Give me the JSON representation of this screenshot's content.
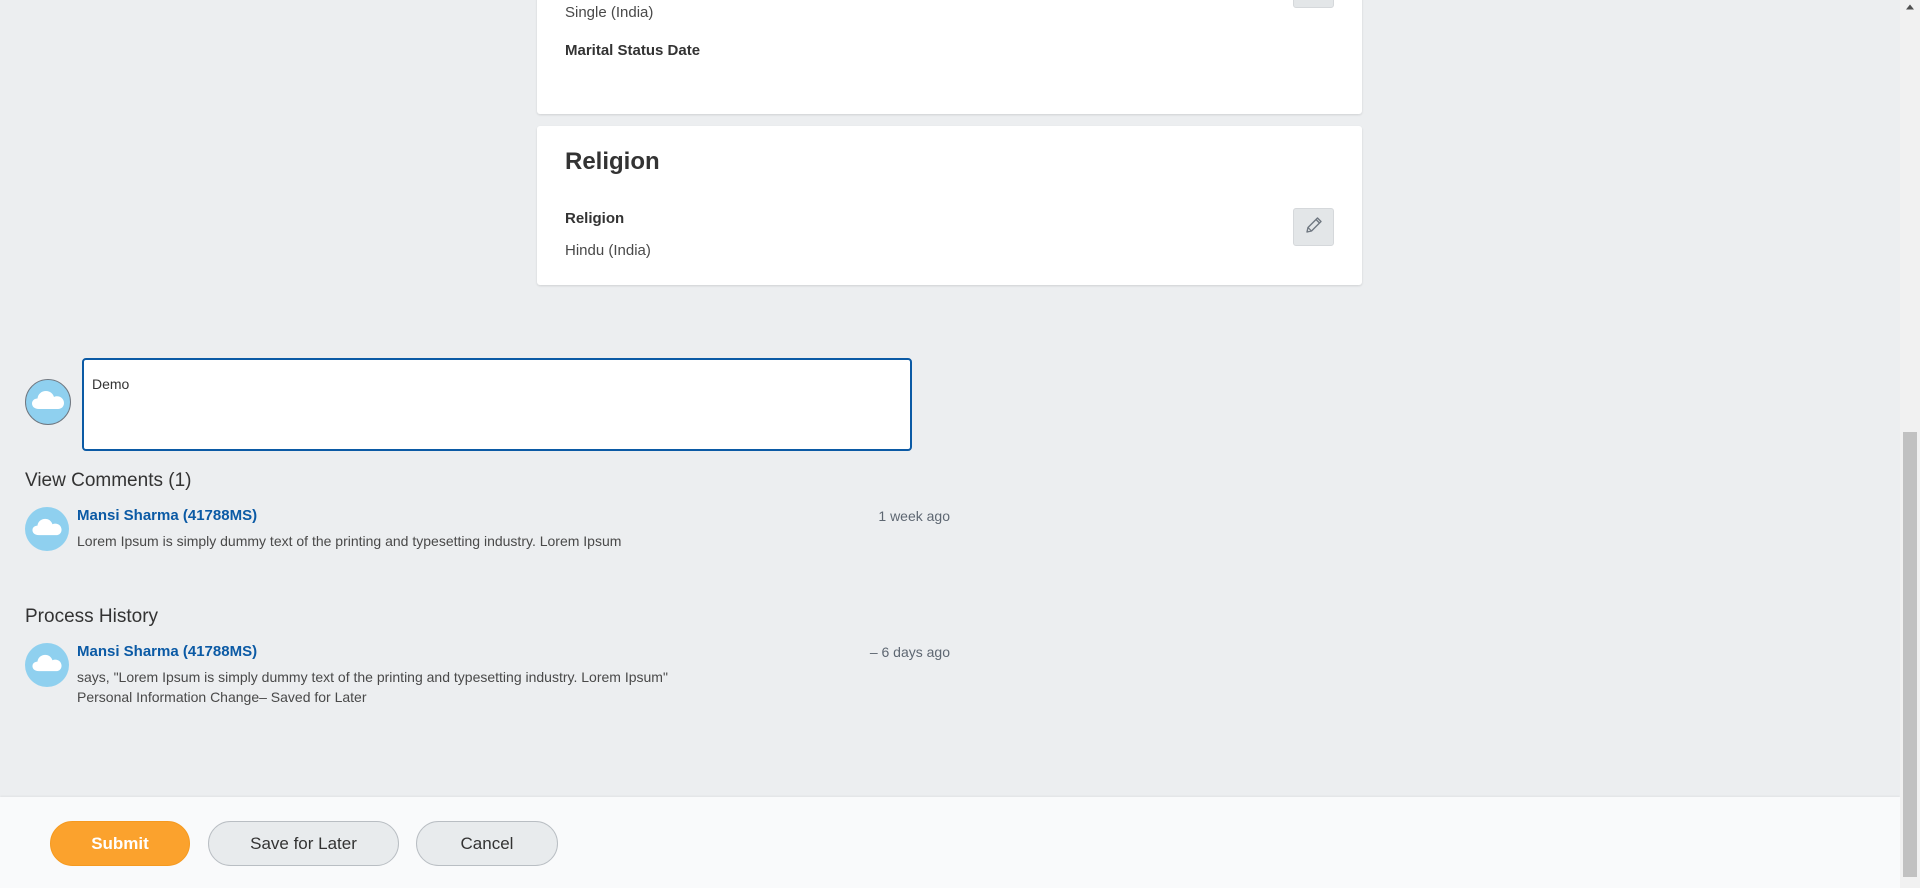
{
  "marital_card": {
    "status_value": "Single (India)",
    "status_date_label": "Marital Status Date"
  },
  "religion_card": {
    "title": "Religion",
    "field_label": "Religion",
    "field_value": "Hindu (India)"
  },
  "comment_box": {
    "value": "Demo"
  },
  "view_comments": {
    "heading": "View Comments (1)",
    "items": [
      {
        "author": "Mansi Sharma (41788MS)",
        "time": "1 week ago",
        "text": "Lorem Ipsum is simply dummy text of the printing and typesetting industry. Lorem Ipsum"
      }
    ]
  },
  "process_history": {
    "heading": "Process History",
    "items": [
      {
        "author": "Mansi Sharma (41788MS)",
        "time": "– 6 days ago",
        "line1": "says, \"Lorem Ipsum is simply dummy text of the printing and typesetting industry. Lorem Ipsum\"",
        "line2": "Personal Information Change– Saved for Later"
      }
    ]
  },
  "footer": {
    "submit_label": "Submit",
    "save_label": "Save for Later",
    "cancel_label": "Cancel"
  },
  "icons": {
    "edit": "pencil-icon",
    "avatar": "cloud-icon",
    "scroll_up": "arrow-up-icon"
  },
  "colors": {
    "accent_blue": "#0b5aa5",
    "submit_orange": "#fba22d",
    "avatar_blue": "#8fd0ef",
    "background": "#eceef0"
  }
}
